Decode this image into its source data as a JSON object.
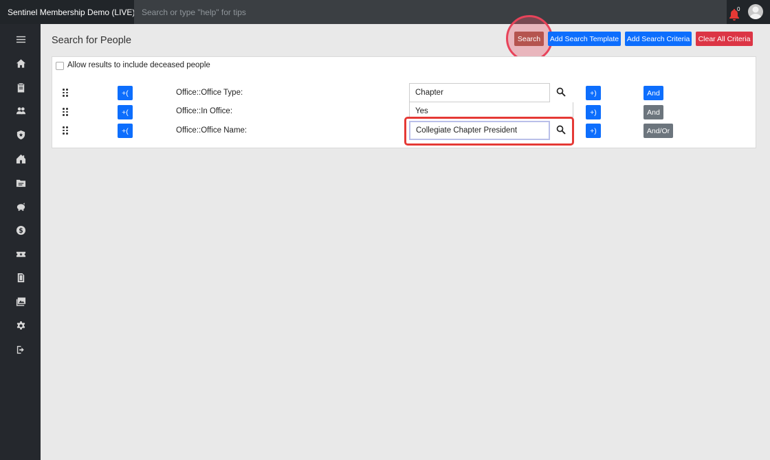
{
  "app": {
    "brand": "Sentinel Membership Demo (LIVE)",
    "search_placeholder": "Search or type \"help\" for tips",
    "notification_count": "0"
  },
  "page": {
    "title": "Search for People",
    "buttons": {
      "search": "Search",
      "add_template": "Add Search Template",
      "add_criteria": "Add Search Criteria",
      "clear_all": "Clear All Criteria"
    },
    "deceased_label": "Allow results to include deceased people"
  },
  "criteria": [
    {
      "open_paren": "+(",
      "label": "Office::Office Type:",
      "value": "Chapter",
      "close_paren": "+)",
      "logic": "And",
      "logic_color": "#0d6efd"
    },
    {
      "open_paren": "+(",
      "label": "Office::In Office:",
      "value": "Yes",
      "close_paren": "+)",
      "logic": "And",
      "logic_color": "#6c757d"
    },
    {
      "open_paren": "+(",
      "label": "Office::Office Name:",
      "value": "Collegiate Chapter President",
      "close_paren": "+)",
      "logic": "And/Or",
      "logic_color": "#6c757d"
    }
  ],
  "sidebar_icons": [
    "menu-icon",
    "home-icon",
    "clipboard-icon",
    "people-icon",
    "shield-icon",
    "house-icon",
    "folder-icon",
    "piggy-bank-icon",
    "dollar-icon",
    "ticket-icon",
    "document-icon",
    "images-icon",
    "gear-icon",
    "logout-icon"
  ],
  "colors": {
    "primary": "#0d6efd",
    "danger": "#dc3545",
    "search_btn": "#b5544f",
    "secondary": "#6c757d",
    "highlight": "#e53935"
  }
}
